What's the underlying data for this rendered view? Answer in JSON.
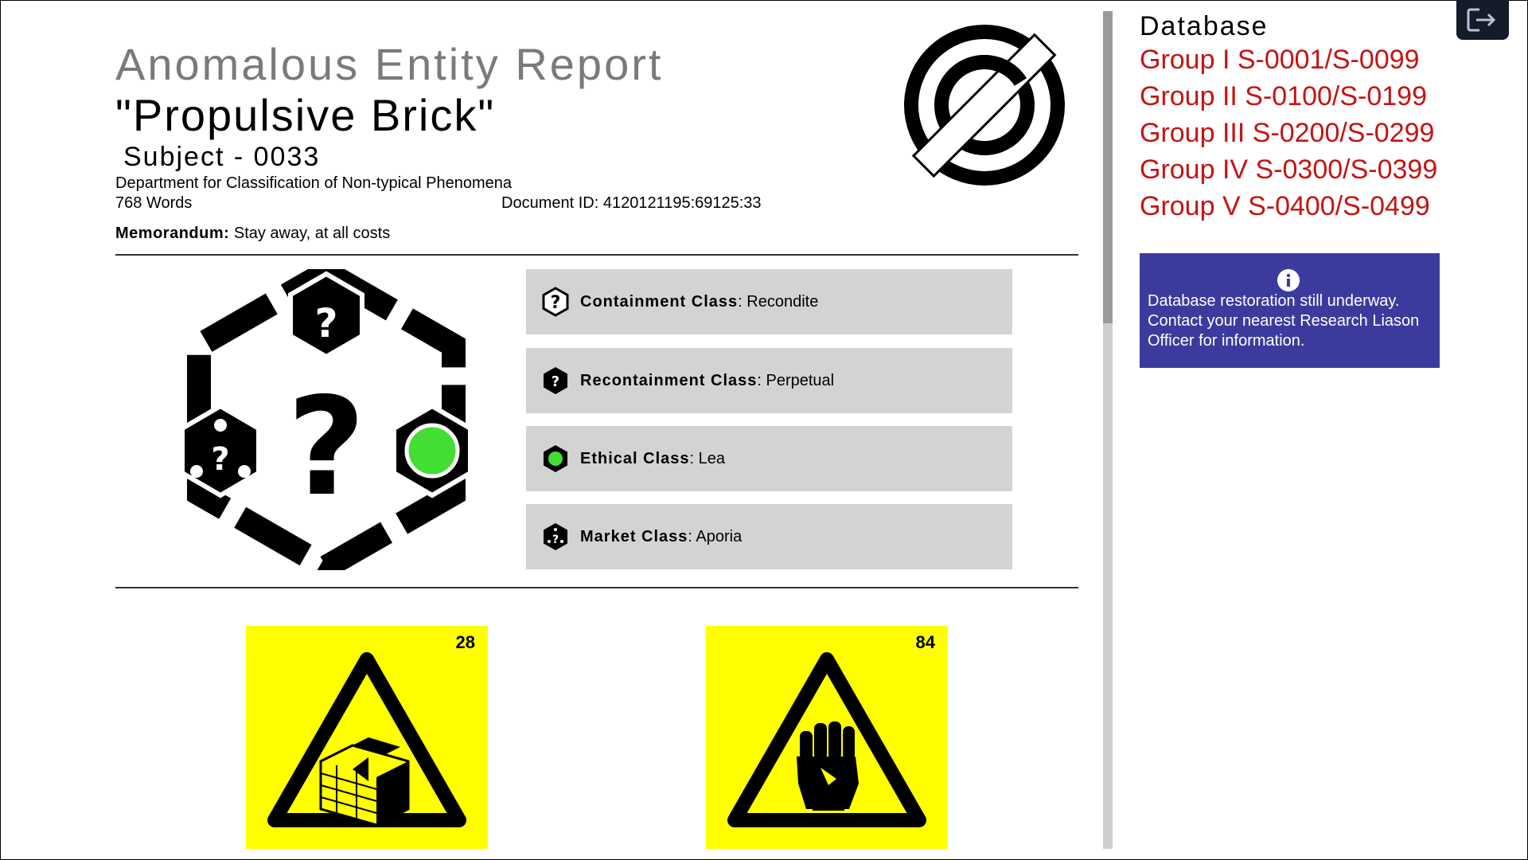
{
  "report": {
    "title": "Anomalous Entity Report",
    "entity_name": "\"Propulsive Brick\"",
    "subject": "Subject - 0033",
    "department": "Department for Classification of Non-typical Phenomena",
    "word_count": "768 Words",
    "document_id": "Document ID: 4120121195:69125:33",
    "memorandum_label": "Memorandum:",
    "memorandum_text": " Stay away, at all costs"
  },
  "classes": [
    {
      "key": "Containment Class",
      "value": ": Recondite",
      "icon": "question-outline-hexagon-icon"
    },
    {
      "key": "Recontainment Class",
      "value": ": Perpetual",
      "icon": "question-black-hexagon-icon"
    },
    {
      "key": "Ethical Class",
      "value": ": Lea",
      "icon": "green-dot-hexagon-icon"
    },
    {
      "key": "Market Class",
      "value": ": Aporia",
      "icon": "dots-question-hexagon-icon"
    }
  ],
  "hazards": [
    {
      "number": "28",
      "icon": "brick-wall-warning-icon"
    },
    {
      "number": "84",
      "icon": "raised-fist-warning-icon"
    }
  ],
  "sidebar": {
    "title": "Database",
    "groups": [
      "Group I S-0001/S-0099",
      "Group II S-0100/S-0199",
      "Group III S-0200/S-0299",
      "Group IV S-0300/S-0399",
      "Group V S-0400/S-0499"
    ],
    "notice": "Database restoration still underway. Contact your nearest Research Liason Officer for information."
  },
  "colors": {
    "link": "#c41414",
    "notice_bg": "#3b3b9e",
    "class_row_bg": "#d3d3d3",
    "hazard_bg": "#ffff00",
    "ethical_green": "#44dd33"
  }
}
